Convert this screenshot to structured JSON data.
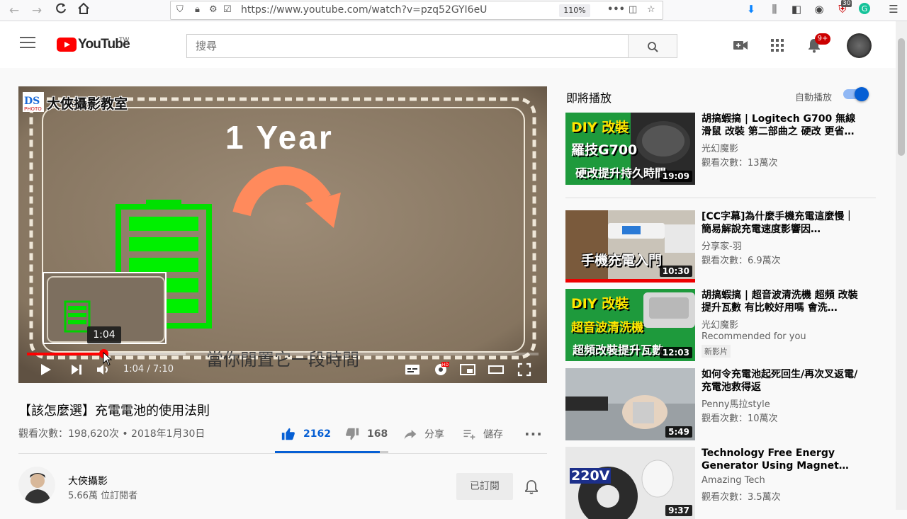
{
  "browser": {
    "url": "https://www.youtube.com/watch?v=pzq52GYI6eU",
    "zoom": "110%",
    "ext_badge": "30"
  },
  "masthead": {
    "logo_text": "YouTube",
    "region": "TW",
    "search_placeholder": "搜尋",
    "notification_count": "9+"
  },
  "player": {
    "overlay_title": "1 Year",
    "watermark": "大俠攝影教室",
    "subtitle": "當你閒置它一段時間",
    "preview_time": "1:04",
    "time_display": "1:04 / 7:10",
    "progress": 0.149,
    "buffered": 0.31
  },
  "video": {
    "title": "【該怎麼選】充電電池的使用法則",
    "view_info": "觀看次數：198,620次 • 2018年1月30日",
    "likes": "2162",
    "dislikes": "168",
    "share_label": "分享",
    "save_label": "儲存",
    "like_ratio": 0.928
  },
  "owner": {
    "name": "大俠攝影",
    "subscribers": "5.66萬 位訂閱者",
    "subscribed_label": "已訂閱"
  },
  "sidebar": {
    "up_next": "即將播放",
    "autoplay_label": "自動播放",
    "items": [
      {
        "title": "胡搞蝦搞 | Logitech G700 無線滑鼠 改裝 第二部曲之 硬改 更省…",
        "channel": "光幻魔影",
        "views": "觀看次數：13萬次",
        "duration": "19:09",
        "thumb_lines": [
          "DIY 改裝",
          "羅技G700",
          "硬改提升持久時間"
        ]
      },
      {
        "title": "[CC字幕]為什麼手機充電這麼慢｜簡易解說充電速度影響因…",
        "channel": "分享家-羽",
        "views": "觀看次數：6.9萬次",
        "duration": "10:30",
        "thumb_lines": [
          "手機充電入門"
        ]
      },
      {
        "title": "胡搞蝦搞 | 超音波清洗機 超頻 改裝 提升瓦數 有比較好用嗎 會洗…",
        "channel": "光幻魔影",
        "views": "Recommended for you",
        "badge": "新影片",
        "duration": "12:03",
        "thumb_lines": [
          "DIY 改裝",
          "超音波清洗機",
          "超頻改裝提升瓦數"
        ]
      },
      {
        "title": "如何令充電池起死回生/再次叉返電/ 充電池救得返",
        "channel": "Penny馬拉style",
        "views": "觀看次數：10萬次",
        "duration": "5:49",
        "thumb_lines": []
      },
      {
        "title": "Technology Free Energy Generator Using Magnet…",
        "channel": "Amazing Tech",
        "views": "觀看次數：3.5萬次",
        "duration": "9:37",
        "thumb_lines": [
          "220V"
        ]
      }
    ]
  }
}
